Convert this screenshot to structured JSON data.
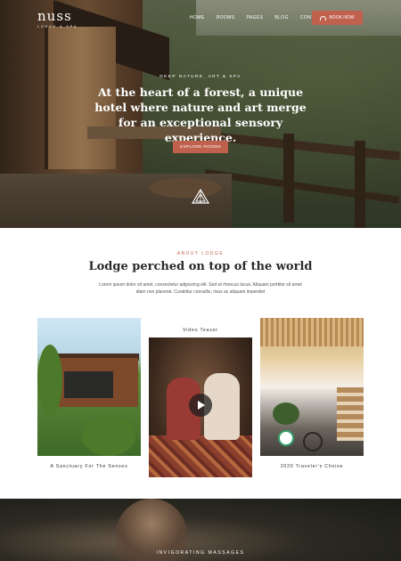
{
  "header": {
    "logo_word": "nuss",
    "logo_sub": "LODGE & SPA",
    "nav": [
      "HOME",
      "ROOMS",
      "PAGES",
      "BLOG",
      "CONTACT"
    ],
    "book_label": "BOOK NOW"
  },
  "hero": {
    "kicker": "DEEP NATURE, ART & SPA",
    "title": "At the heart of a forest, a unique hotel where nature and art merge for an exceptional sensory experience.",
    "cta": "EXPLORE ROOMS"
  },
  "about": {
    "kicker": "ABOUT LODGE",
    "title": "Lodge perched on top of the world",
    "text": "Lorem ipsum dolor sit amet, consectetur adipiscing elit. Sed et rhoncus lacus. Aliquam porttitor sit amet diam non placerat. Curabitur convallis, risus ac aliquam imperdiet"
  },
  "cards": [
    {
      "caption": "A Sanctuary For The Senses"
    },
    {
      "label": "Video Teaser"
    },
    {
      "caption": "2020 Traveler's Choise"
    }
  ],
  "bottom": {
    "kicker": "INVIGORATING MASSAGES"
  },
  "colors": {
    "accent": "#c0614d"
  },
  "icons": {
    "book": "bell-icon",
    "emblem": "mountain-emblem-icon",
    "play": "play-icon"
  }
}
